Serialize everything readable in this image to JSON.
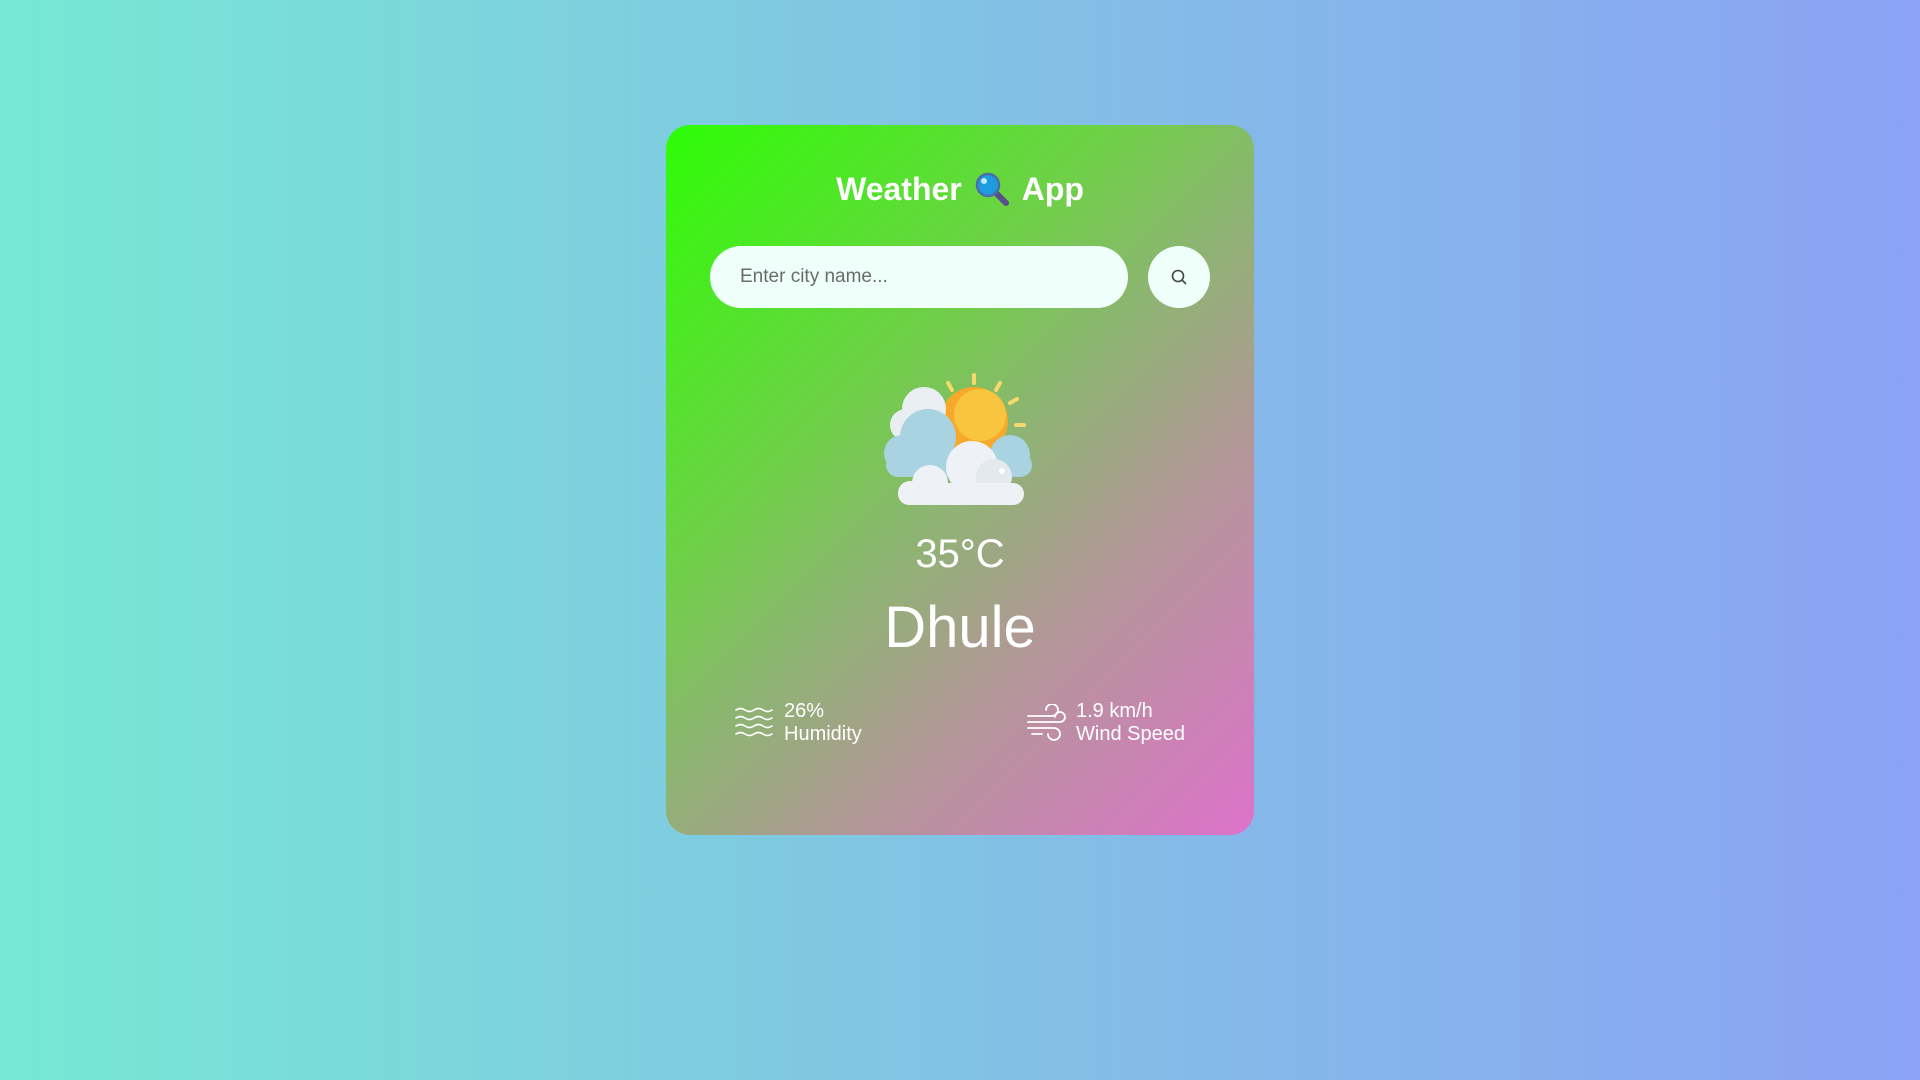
{
  "app": {
    "title_left": "Weather",
    "title_right": "App",
    "title_icon": "magnifier-icon"
  },
  "search": {
    "placeholder": "Enter city name...",
    "value": "",
    "button_icon": "search-icon"
  },
  "weather": {
    "icon": "partly-cloudy-sun-icon",
    "temperature": "35°C",
    "city": "Dhule"
  },
  "details": {
    "humidity": {
      "icon": "humidity-waves-icon",
      "value": "26%",
      "label": "Humidity"
    },
    "wind": {
      "icon": "wind-icon",
      "value": "1.9 km/h",
      "label": "Wind Speed"
    }
  },
  "colors": {
    "card_gradient_start": "#2dfe06",
    "card_gradient_end": "#de72cb",
    "page_gradient_start": "#76e8d4",
    "page_gradient_end": "#8ba2f5",
    "input_background": "#effffa"
  }
}
